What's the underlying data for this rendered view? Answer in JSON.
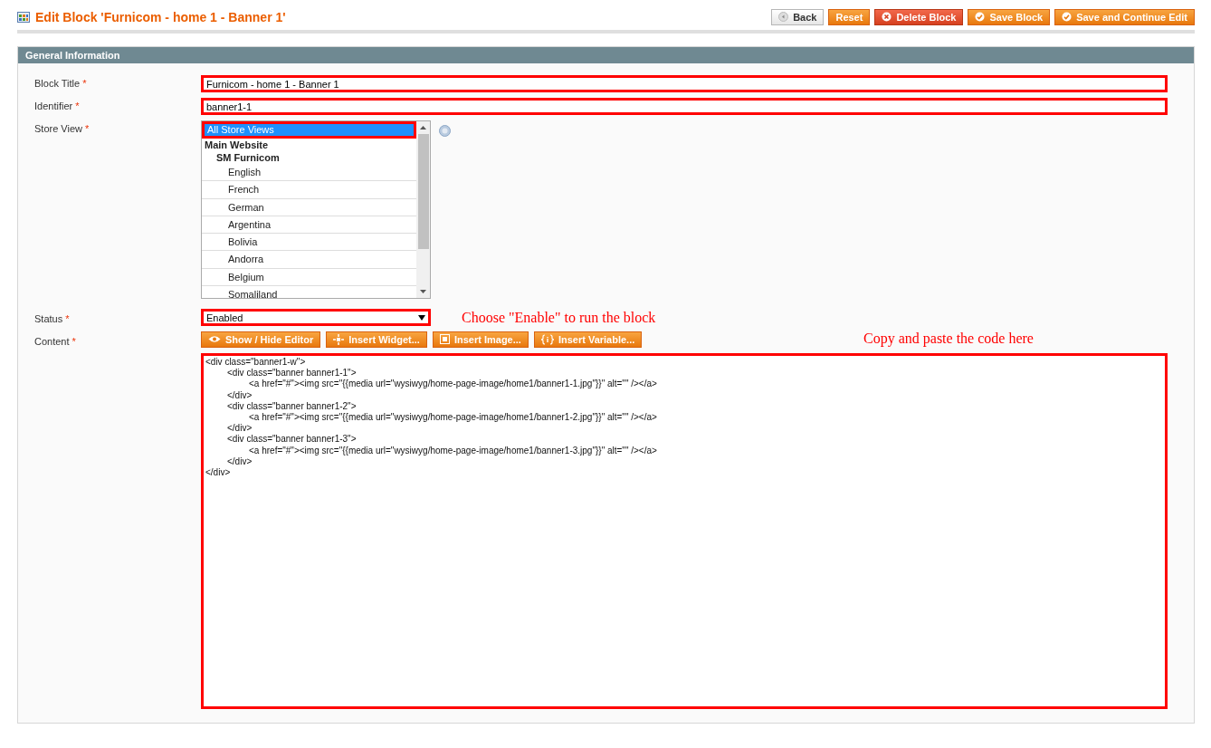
{
  "page_title": "Edit Block 'Furnicom - home 1 - Banner 1'",
  "actions": [
    {
      "label": "Back",
      "kind": "back"
    },
    {
      "label": "Reset",
      "kind": "plain"
    },
    {
      "label": "Delete Block",
      "kind": "delete"
    },
    {
      "label": "Save Block",
      "kind": "save"
    },
    {
      "label": "Save and Continue Edit",
      "kind": "save"
    }
  ],
  "section": {
    "title": "General Information"
  },
  "fields": {
    "block_title": {
      "label": "Block Title",
      "required_mark": "*",
      "value": "Furnicom - home 1 - Banner 1",
      "highlighted": true
    },
    "identifier": {
      "label": "Identifier",
      "required_mark": "*",
      "value": "banner1-1",
      "highlighted": true
    },
    "store_view": {
      "label": "Store View",
      "required_mark": "*",
      "options": [
        {
          "label": "All Store Views",
          "selected": true,
          "highlighted": true
        },
        {
          "label": "Main Website",
          "selected": false,
          "children": [
            {
              "label": "SM Furnicom",
              "selected": false,
              "children": [
                {
                  "label": "English",
                  "selected": false
                },
                {
                  "label": "French",
                  "selected": false
                },
                {
                  "label": "German",
                  "selected": false
                },
                {
                  "label": "Argentina",
                  "selected": false
                },
                {
                  "label": "Bolivia",
                  "selected": false
                },
                {
                  "label": "Andorra",
                  "selected": false
                },
                {
                  "label": "Belgium",
                  "selected": false
                },
                {
                  "label": "Somaliland",
                  "selected": false
                }
              ]
            }
          ]
        }
      ]
    },
    "status": {
      "label": "Status",
      "required_mark": "*",
      "value": "Enabled",
      "highlighted": true,
      "annotation": "Choose \"Enable\" to run the block"
    },
    "content": {
      "label": "Content",
      "required_mark": "*",
      "highlighted": true,
      "annotation": "Copy and paste the code here",
      "buttons": [
        {
          "label": "Show / Hide Editor",
          "kind": "eye"
        },
        {
          "label": "Insert Widget...",
          "kind": "widget"
        },
        {
          "label": "Insert Image...",
          "kind": "image"
        },
        {
          "label": "Insert Variable...",
          "kind": "variable"
        }
      ],
      "value": "<div class=\"banner1-w\">\n\t<div class=\"banner banner1-1\">\n\t\t<a href=\"#\"><img src=\"{{media url=\"wysiwyg/home-page-image/home1/banner1-1.jpg\"}}\" alt=\"\" /></a>\n\t</div>\n\t<div class=\"banner banner1-2\">\n\t\t<a href=\"#\"><img src=\"{{media url=\"wysiwyg/home-page-image/home1/banner1-2.jpg\"}}\" alt=\"\" /></a>\n\t</div>\n\t<div class=\"banner banner1-3\">\n\t\t<a href=\"#\"><img src=\"{{media url=\"wysiwyg/home-page-image/home1/banner1-3.jpg\"}}\" alt=\"\" /></a>\n\t</div>\n</div>"
    }
  }
}
